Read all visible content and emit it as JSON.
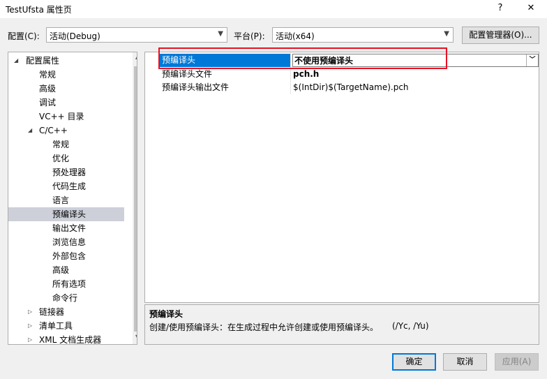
{
  "window": {
    "title": "TestUfsta 属性页",
    "help": "?",
    "close": "✕"
  },
  "config": {
    "config_label": "配置(C):",
    "config_value": "活动(Debug)",
    "platform_label": "平台(P):",
    "platform_value": "活动(x64)",
    "manager_button": "配置管理器(O)..."
  },
  "tree": {
    "items": [
      {
        "label": "配置属性"
      },
      {
        "label": "常规"
      },
      {
        "label": "高级"
      },
      {
        "label": "调试"
      },
      {
        "label": "VC++ 目录"
      },
      {
        "label": "C/C++"
      },
      {
        "label": "常规"
      },
      {
        "label": "优化"
      },
      {
        "label": "预处理器"
      },
      {
        "label": "代码生成"
      },
      {
        "label": "语言"
      },
      {
        "label": "预编译头"
      },
      {
        "label": "输出文件"
      },
      {
        "label": "浏览信息"
      },
      {
        "label": "外部包含"
      },
      {
        "label": "高级"
      },
      {
        "label": "所有选项"
      },
      {
        "label": "命令行"
      },
      {
        "label": "链接器"
      },
      {
        "label": "清单工具"
      },
      {
        "label": "XML 文档生成器"
      }
    ]
  },
  "grid": {
    "rows": [
      {
        "name": "预编译头",
        "value": "不使用预编译头"
      },
      {
        "name": "预编译头文件",
        "value": "pch.h"
      },
      {
        "name": "预编译头输出文件",
        "value": "$(IntDir)$(TargetName).pch"
      }
    ]
  },
  "description": {
    "title": "预编译头",
    "text": "创建/使用预编译头：在生成过程中允许创建或使用预编译头。",
    "switches": "(/Yc, /Yu)"
  },
  "footer": {
    "ok": "确定",
    "cancel": "取消",
    "apply": "应用(A)"
  },
  "colors": {
    "selection": "#0078d7",
    "tree_selection": "#cdd0d9",
    "highlight_box": "#e81123"
  }
}
